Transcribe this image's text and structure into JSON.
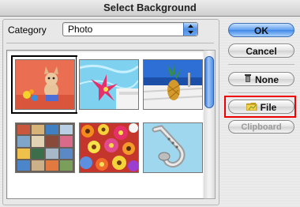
{
  "window": {
    "title": "Select Background"
  },
  "category": {
    "label": "Category",
    "selected": "Photo"
  },
  "thumbnails": [
    {
      "name": "chihuahua",
      "selected": true
    },
    {
      "name": "flower-pool",
      "selected": false
    },
    {
      "name": "pineapple-beach",
      "selected": false
    },
    {
      "name": "photo-collage",
      "selected": false
    },
    {
      "name": "flower-bouquet",
      "selected": false
    },
    {
      "name": "saxophone",
      "selected": false
    }
  ],
  "buttons": {
    "ok": "OK",
    "cancel": "Cancel",
    "none": "None",
    "file": "File",
    "clipboard": "Clipboard"
  },
  "colors": {
    "accent": "#3f87e8",
    "highlight": "#ee0000"
  }
}
